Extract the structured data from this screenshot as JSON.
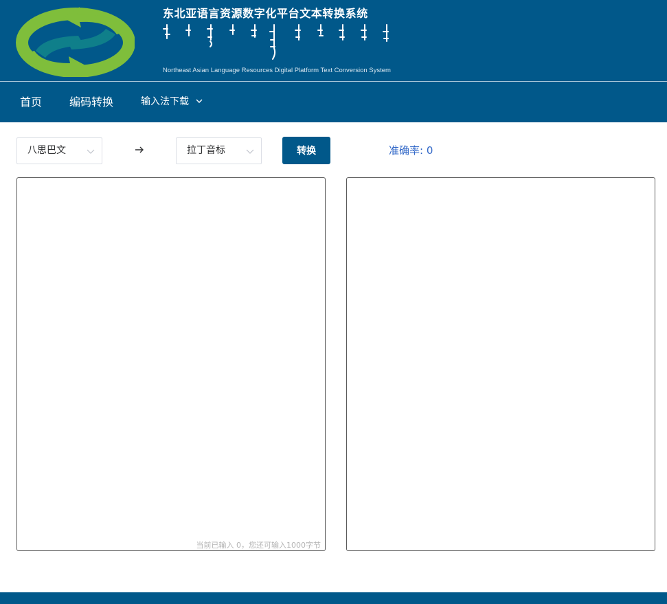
{
  "header": {
    "title_cn": "东北亚语言资源数字化平台文本转换系统",
    "title_en": "Northeast Asian Language Resources Digital Platform Text Conversion System"
  },
  "nav": {
    "items": [
      {
        "label": "首页"
      },
      {
        "label": "编码转换"
      },
      {
        "label": "输入法下载"
      }
    ]
  },
  "toolbar": {
    "source_select": "八思巴文",
    "target_select": "拉丁音标",
    "convert_label": "转换",
    "accuracy_text": "准确率: 0"
  },
  "input_panel": {
    "value": "",
    "counter_text": "当前已输入 0，您还可输入1000字节"
  },
  "output_panel": {
    "value": ""
  },
  "colors": {
    "brand": "#01588a",
    "accent_text": "#2f66c7",
    "logo_green": "#7fbe3b",
    "logo_teal": "#0f7f8a"
  },
  "icons": {
    "logo": "recycle-arrows-icon",
    "arrow": "arrow-right-icon",
    "dropdown": "chevron-down-icon"
  }
}
